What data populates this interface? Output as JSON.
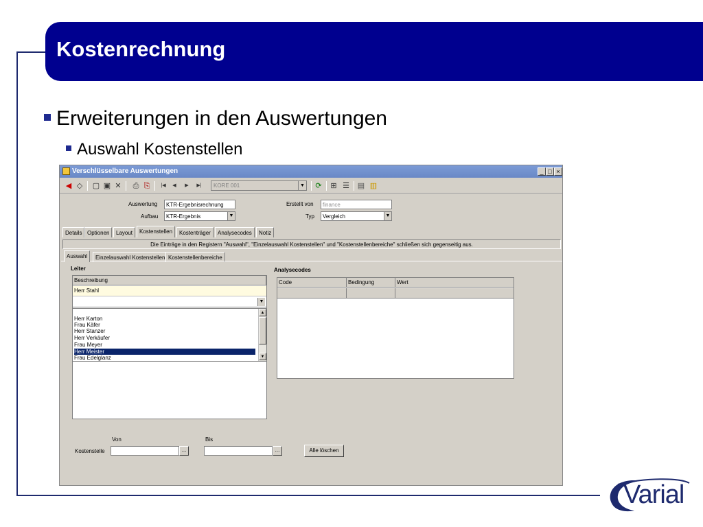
{
  "slide": {
    "title": "Kostenrechnung",
    "bullet1": "Erweiterungen in den Auswertungen",
    "bullet2": "Auswahl Kostenstellen",
    "logo": "Varial",
    "colors": {
      "title_bar": "#00008f",
      "frame": "#1e2a6e"
    }
  },
  "window": {
    "title": "Verschlüsselbare Auswertungen",
    "controls": [
      "_",
      "□",
      "×"
    ],
    "toolbar": {
      "combo_value": "KORE 001",
      "icons": [
        "back-arrow-icon",
        "forward-icon",
        "new-document-icon",
        "save-icon",
        "delete-icon",
        "print-icon",
        "print-preview-icon",
        "first-record-icon",
        "previous-record-icon",
        "next-record-icon",
        "last-record-icon",
        "refresh-icon",
        "tree-icon",
        "list-icon",
        "copy-icon",
        "lock-icon"
      ]
    },
    "form": {
      "auswertung_label": "Auswertung",
      "auswertung_value": "KTR-Ergebnisrechnung",
      "aufbau_label": "Aufbau",
      "aufbau_value": "KTR-Ergebnis",
      "erstellt_label": "Erstellt von",
      "erstellt_value": "finance",
      "typ_label": "Typ",
      "typ_value": "Vergleich"
    },
    "tabs": [
      "Details",
      "Optionen",
      "Layout",
      "Kostenstellen",
      "Kostenträger",
      "Analysecodes",
      "Notiz"
    ],
    "active_tab": "Kostenstellen",
    "info": "Die Einträge in den Registern \"Auswahl\", \"Einzelauswahl Kostenstellen\" und \"Kostenstellenbereiche\" schließen sich gegenseitig aus.",
    "subtabs": [
      "Auswahl",
      "Einzelauswahl Kostenstellen",
      "Kostenstellenbereiche"
    ],
    "active_subtab": "Auswahl",
    "leiter": {
      "label": "Leiter",
      "column": "Beschreibung",
      "selected": "Herr Stahl",
      "items": [
        "Herr Karton",
        "Frau Käfer",
        "Herr Stanzer",
        "Herr Verkäufer",
        "Frau Meyer",
        "Herr Meister",
        "Frau Edelglanz"
      ],
      "highlighted": "Herr Meister"
    },
    "analysecodes": {
      "label": "Analysecodes",
      "columns": [
        "Code",
        "Bedingung",
        "Wert"
      ]
    },
    "kostenstelle": {
      "von_label": "Von",
      "bis_label": "Bis",
      "label": "Kostenstelle",
      "von_value": "",
      "bis_value": "",
      "ellipsis": "...",
      "clear_button": "Alle löschen"
    }
  }
}
